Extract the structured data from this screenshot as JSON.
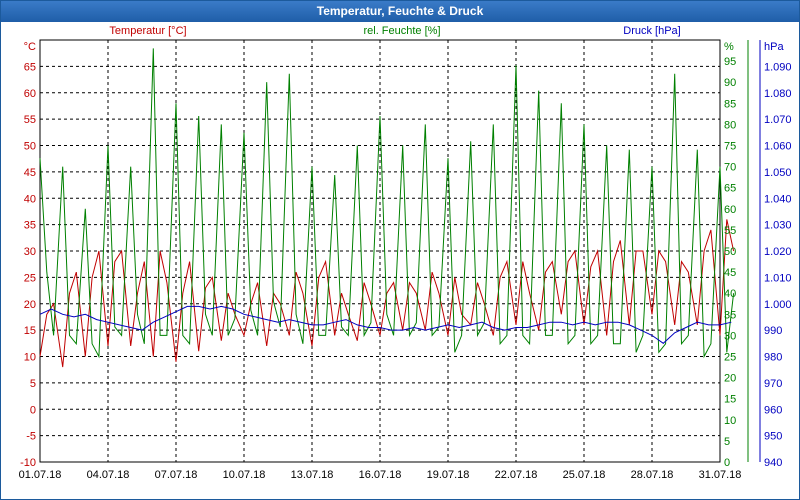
{
  "window": {
    "title": "Temperatur, Feuchte & Druck"
  },
  "chart_data": {
    "type": "line",
    "title": "Temperatur, Feuchte & Druck",
    "x": [
      "01.07.18",
      "04.07.18",
      "07.07.18",
      "10.07.18",
      "13.07.18",
      "16.07.18",
      "19.07.18",
      "22.07.18",
      "25.07.18",
      "28.07.18",
      "31.07.18"
    ],
    "xlim": [
      "01.07.18",
      "31.07.18"
    ],
    "grid": true,
    "axes": {
      "left": {
        "unit": "°C",
        "ylim": [
          -10,
          70
        ],
        "ticks": [
          -10,
          -5,
          0,
          5,
          10,
          15,
          20,
          25,
          30,
          35,
          40,
          45,
          50,
          55,
          60,
          65
        ],
        "color": "#c00000"
      },
      "right1": {
        "unit": "%",
        "ylim": [
          0,
          100
        ],
        "ticks": [
          0,
          5,
          10,
          15,
          20,
          25,
          30,
          35,
          40,
          45,
          50,
          55,
          60,
          65,
          70,
          75,
          80,
          85,
          90,
          95
        ],
        "color": "#008000"
      },
      "right2": {
        "unit": "hPa",
        "ylim": [
          940,
          1100
        ],
        "ticks": [
          "940",
          "950",
          "960",
          "970",
          "980",
          "990",
          "1.000",
          "1.010",
          "1.020",
          "1.030",
          "1.040",
          "1.050",
          "1.060",
          "1.070",
          "1.080",
          "1.090"
        ],
        "color": "#0000c0"
      }
    },
    "series": [
      {
        "name": "Temperatur [°C]",
        "color": "#c00000",
        "axis": "left",
        "days": [
          0,
          0.3,
          0.6,
          1,
          1.3,
          1.6,
          2,
          2.3,
          2.6,
          3,
          3.3,
          3.6,
          4,
          4.3,
          4.6,
          5,
          5.3,
          5.6,
          6,
          6.3,
          6.6,
          7,
          7.3,
          7.6,
          8,
          8.3,
          8.6,
          9,
          9.3,
          9.6,
          10,
          10.3,
          10.6,
          11,
          11.3,
          11.6,
          12,
          12.3,
          12.6,
          13,
          13.3,
          13.6,
          14,
          14.3,
          14.6,
          15,
          15.3,
          15.6,
          16,
          16.3,
          16.6,
          17,
          17.3,
          17.6,
          18,
          18.3,
          18.6,
          19,
          19.3,
          19.6,
          20,
          20.3,
          20.6,
          21,
          21.3,
          21.6,
          22,
          22.3,
          22.6,
          23,
          23.3,
          23.6,
          24,
          24.3,
          24.6,
          25,
          25.3,
          25.6,
          26,
          26.3,
          26.6,
          27,
          27.3,
          27.6,
          28,
          28.3,
          28.6,
          29,
          29.3,
          29.6,
          30,
          30.3,
          30.6
        ],
        "values": [
          10,
          18,
          20,
          8,
          22,
          26,
          10,
          25,
          30,
          12,
          28,
          30,
          12,
          22,
          28,
          10,
          30,
          24,
          9,
          22,
          28,
          11,
          23,
          25,
          13,
          22,
          18,
          14,
          20,
          24,
          12,
          22,
          20,
          14,
          26,
          22,
          12,
          25,
          28,
          14,
          22,
          18,
          13,
          24,
          20,
          14,
          22,
          24,
          15,
          24,
          22,
          15,
          26,
          22,
          14,
          25,
          18,
          16,
          24,
          20,
          14,
          25,
          28,
          16,
          28,
          22,
          15,
          26,
          28,
          18,
          28,
          30,
          16,
          27,
          30,
          14,
          28,
          32,
          16,
          30,
          30,
          18,
          30,
          28,
          16,
          28,
          26,
          16,
          30,
          34,
          14,
          36,
          30
        ]
      },
      {
        "name": "rel. Feuchte [%]",
        "color": "#008000",
        "axis": "right1",
        "days": [
          0,
          0.3,
          0.6,
          1,
          1.3,
          1.6,
          2,
          2.3,
          2.6,
          3,
          3.3,
          3.6,
          4,
          4.3,
          4.6,
          5,
          5.3,
          5.6,
          6,
          6.3,
          6.6,
          7,
          7.3,
          7.6,
          8,
          8.3,
          8.6,
          9,
          9.3,
          9.6,
          10,
          10.3,
          10.6,
          11,
          11.3,
          11.6,
          12,
          12.3,
          12.6,
          13,
          13.3,
          13.6,
          14,
          14.3,
          14.6,
          15,
          15.3,
          15.6,
          16,
          16.3,
          16.6,
          17,
          17.3,
          17.6,
          18,
          18.3,
          18.6,
          19,
          19.3,
          19.6,
          20,
          20.3,
          20.6,
          21,
          21.3,
          21.6,
          22,
          22.3,
          22.6,
          23,
          23.3,
          23.6,
          24,
          24.3,
          24.6,
          25,
          25.3,
          25.6,
          26,
          26.3,
          26.6,
          27,
          27.3,
          27.6,
          28,
          28.3,
          28.6,
          29,
          29.3,
          29.6,
          30,
          30.3,
          30.6
        ],
        "values": [
          72,
          45,
          30,
          70,
          30,
          28,
          60,
          28,
          25,
          75,
          32,
          30,
          70,
          35,
          28,
          98,
          30,
          30,
          85,
          30,
          28,
          82,
          35,
          30,
          80,
          30,
          34,
          78,
          36,
          30,
          90,
          38,
          32,
          92,
          35,
          28,
          70,
          30,
          30,
          68,
          32,
          30,
          75,
          30,
          33,
          82,
          35,
          30,
          75,
          30,
          33,
          80,
          30,
          32,
          72,
          26,
          30,
          76,
          30,
          33,
          80,
          28,
          30,
          94,
          30,
          28,
          88,
          30,
          30,
          85,
          28,
          30,
          80,
          28,
          30,
          75,
          28,
          28,
          74,
          26,
          30,
          70,
          26,
          28,
          92,
          28,
          30,
          74,
          25,
          28,
          70,
          26,
          40
        ]
      },
      {
        "name": "Druck [hPa]",
        "color": "#0000c0",
        "axis": "right2",
        "days": [
          0,
          0.5,
          1,
          1.5,
          2,
          2.5,
          3,
          3.5,
          4,
          4.5,
          5,
          5.5,
          6,
          6.5,
          7,
          7.5,
          8,
          8.5,
          9,
          9.5,
          10,
          10.5,
          11,
          11.5,
          12,
          12.5,
          13,
          13.5,
          14,
          14.5,
          15,
          15.5,
          16,
          16.5,
          17,
          17.5,
          18,
          18.5,
          19,
          19.5,
          20,
          20.5,
          21,
          21.5,
          22,
          22.5,
          23,
          23.5,
          24,
          24.5,
          25,
          25.5,
          26,
          26.5,
          27,
          27.5,
          28,
          28.5,
          29,
          29.5,
          30,
          30.5
        ],
        "values": [
          996,
          998,
          996,
          995,
          996,
          994,
          993,
          992,
          991,
          990,
          993,
          995,
          997,
          999,
          999,
          998,
          999,
          998,
          996,
          995,
          994,
          993,
          994,
          993,
          992,
          992,
          993,
          994,
          992,
          991,
          991,
          990,
          990,
          991,
          990,
          991,
          992,
          991,
          992,
          993,
          991,
          990,
          991,
          991,
          992,
          993,
          993,
          992,
          993,
          992,
          993,
          993,
          992,
          990,
          988,
          985,
          989,
          991,
          993,
          992,
          992,
          993
        ]
      }
    ]
  }
}
